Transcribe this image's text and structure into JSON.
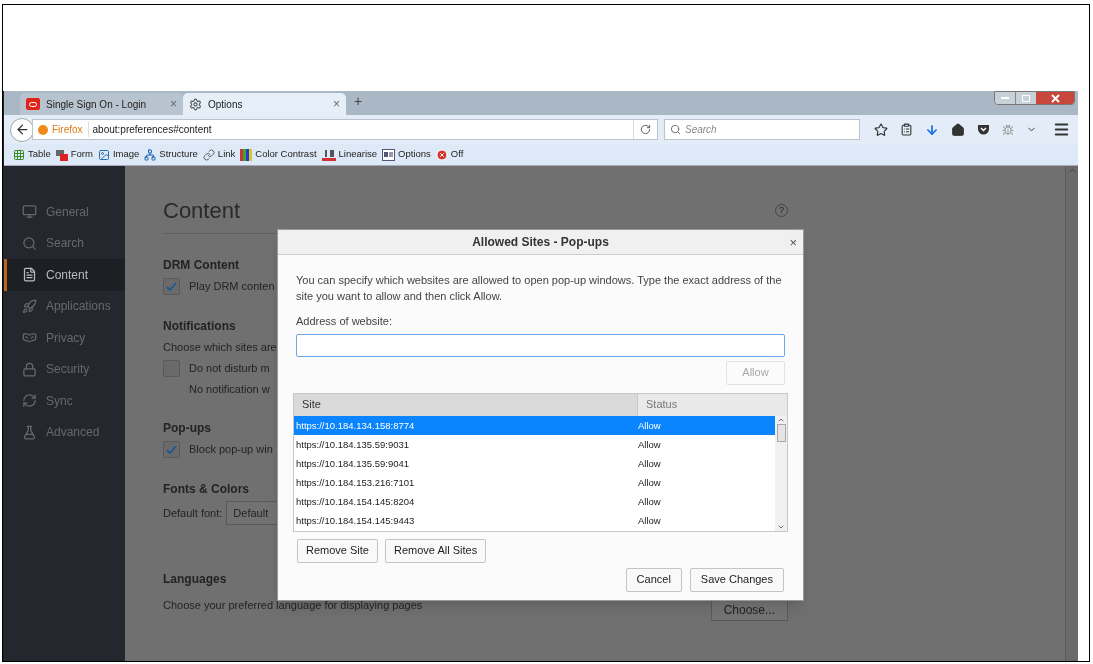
{
  "tabs": [
    {
      "title": "Single Sign On - Login",
      "kind": "oracle",
      "selected": false,
      "close": "×"
    },
    {
      "title": "Options",
      "kind": "gear",
      "selected": true,
      "close": "×"
    }
  ],
  "new_tab": "+",
  "nav": {
    "identity": "Firefox",
    "url": "about:preferences#content",
    "search_placeholder": "Search"
  },
  "bookmarks": [
    {
      "label": "Table",
      "kind": "table"
    },
    {
      "label": "Form",
      "kind": "form"
    },
    {
      "label": "Image",
      "kind": "image"
    },
    {
      "label": "Structure",
      "kind": "structure"
    },
    {
      "label": "Link",
      "kind": "link"
    },
    {
      "label": "Color Contrast",
      "kind": "contrast"
    },
    {
      "label": "Linearise",
      "kind": "linearise"
    },
    {
      "label": "Options",
      "kind": "options"
    },
    {
      "label": "Off",
      "kind": "off"
    }
  ],
  "sidebar": {
    "items": [
      {
        "label": "General",
        "kind": "general",
        "selected": false
      },
      {
        "label": "Search",
        "kind": "search",
        "selected": false
      },
      {
        "label": "Content",
        "kind": "content",
        "selected": true
      },
      {
        "label": "Applications",
        "kind": "applications",
        "selected": false
      },
      {
        "label": "Privacy",
        "kind": "privacy",
        "selected": false
      },
      {
        "label": "Security",
        "kind": "security",
        "selected": false
      },
      {
        "label": "Sync",
        "kind": "sync",
        "selected": false
      },
      {
        "label": "Advanced",
        "kind": "advanced",
        "selected": false
      }
    ]
  },
  "page": {
    "title": "Content",
    "help": "?",
    "sections": [
      {
        "heading": "DRM Content",
        "items": [
          {
            "kind": "checkbox",
            "label": "Play DRM conten",
            "checked": true
          }
        ]
      },
      {
        "heading": "Notifications",
        "items": [
          {
            "kind": "text",
            "label": "Choose which sites are"
          },
          {
            "kind": "checkbox",
            "label": "Do not disturb m",
            "checked": false
          },
          {
            "kind": "note",
            "label": "No notification w"
          }
        ]
      },
      {
        "heading": "Pop-ups",
        "items": [
          {
            "kind": "checkbox",
            "label": "Block pop-up win",
            "checked": true
          }
        ]
      },
      {
        "heading": "Fonts & Colors",
        "items": [
          {
            "kind": "select",
            "label": "Default font:",
            "value": "Default"
          }
        ]
      },
      {
        "heading": "Languages",
        "items": [
          {
            "kind": "text_button",
            "label": "Choose your preferred language for displaying pages",
            "button": "Choose..."
          }
        ]
      }
    ]
  },
  "dialog": {
    "title": "Allowed Sites - Pop-ups",
    "close": "×",
    "intro": "You can specify which websites are allowed to open pop-up windows. Type the exact address of the site you want to allow and then click Allow.",
    "address_label": "Address of website:",
    "allow_button": {
      "label": "Allow",
      "disabled": true
    },
    "table": {
      "columns": [
        "Site",
        "Status"
      ],
      "rows": [
        {
          "site": "https://10.184.134.158:8774",
          "status": "Allow",
          "selected": true
        },
        {
          "site": "https://10.184.135.59:9031",
          "status": "Allow",
          "selected": false
        },
        {
          "site": "https://10.184.135.59:9041",
          "status": "Allow",
          "selected": false
        },
        {
          "site": "https://10.184.153.216:7101",
          "status": "Allow",
          "selected": false
        },
        {
          "site": "https://10.184.154.145:8204",
          "status": "Allow",
          "selected": false
        },
        {
          "site": "https://10.184.154.145:9443",
          "status": "Allow",
          "selected": false
        }
      ]
    },
    "remove_buttons": [
      "Remove Site",
      "Remove All Sites"
    ],
    "footer_buttons": [
      "Cancel",
      "Save Changes"
    ]
  }
}
